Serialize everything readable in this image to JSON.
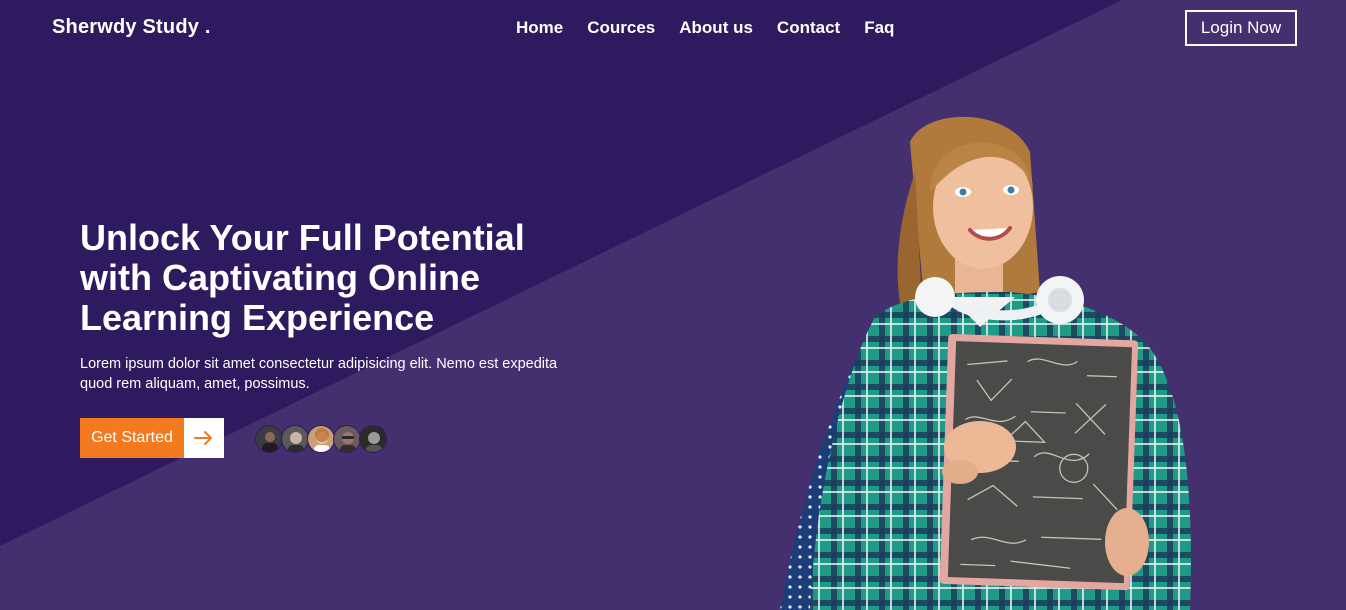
{
  "brand": "Sherwdy Study .",
  "nav": [
    "Home",
    "Cources",
    "About us",
    "Contact",
    "Faq"
  ],
  "login_label": "Login Now",
  "hero": {
    "title": "Unlock Your Full Potential with Captivating Online Learning Experience",
    "text": "Lorem ipsum dolor sit amet consectetur adipisicing elit. Nemo est expedita quod rem aliquam, amet, possimus.",
    "cta_label": "Get Started"
  },
  "icons": {
    "cta_arrow": "arrow-right-icon"
  },
  "colors": {
    "dark_purple": "#2e1a5e",
    "light_purple": "#44306e",
    "accent_orange": "#f47a1f"
  }
}
